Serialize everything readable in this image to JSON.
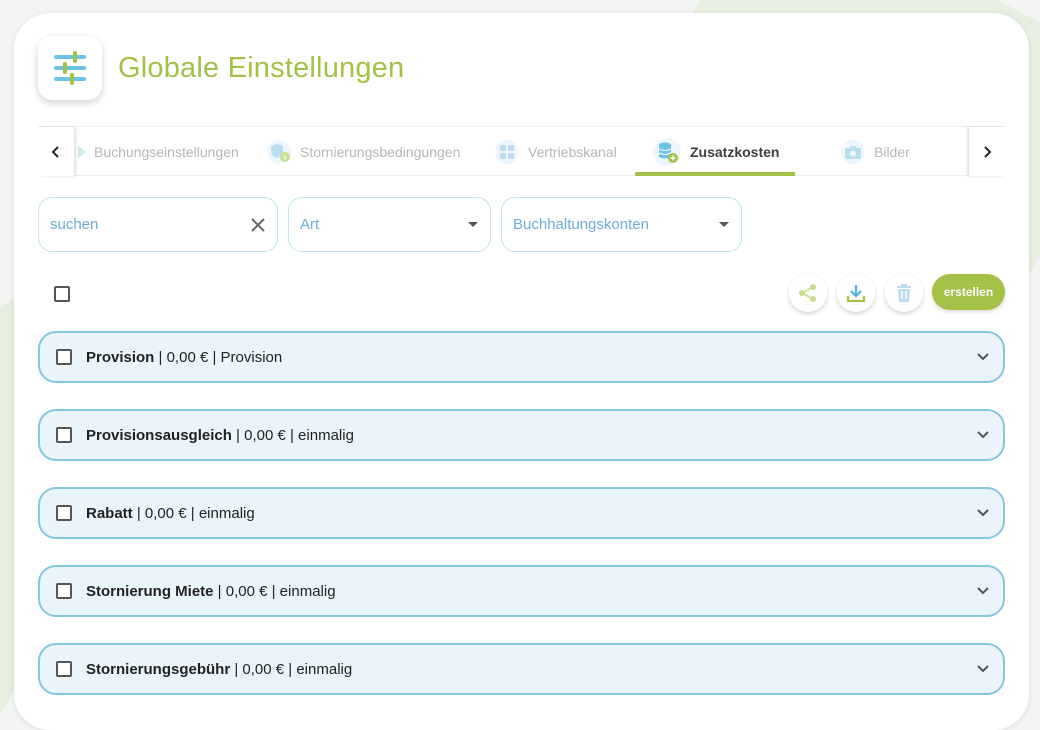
{
  "page": {
    "title": "Globale Einstellungen"
  },
  "tabs": [
    {
      "label": "Buchungseinstellungen",
      "icon": "arrow-icon",
      "active": false
    },
    {
      "label": "Stornierungsbedingungen",
      "icon": "shield-info-icon",
      "active": false
    },
    {
      "label": "Vertriebskanal",
      "icon": "grid-icon",
      "active": false
    },
    {
      "label": "Zusatzkosten",
      "icon": "database-add-icon",
      "active": true
    },
    {
      "label": "Bilder",
      "icon": "camera-icon",
      "active": false
    }
  ],
  "filters": {
    "search_placeholder": "suchen",
    "type_placeholder": "Art",
    "accounts_placeholder": "Buchhaltungskonten"
  },
  "toolbar": {
    "create_label": "erstellen"
  },
  "rows": [
    {
      "name": "Provision",
      "details": " | 0,00 € | Provision"
    },
    {
      "name": "Provisionsausgleich",
      "details": " | 0,00 € | einmalig"
    },
    {
      "name": "Rabatt",
      "details": " | 0,00 € | einmalig"
    },
    {
      "name": "Stornierung Miete",
      "details": " | 0,00 € | einmalig"
    },
    {
      "name": "Stornierungsgebühr",
      "details": " | 0,00 € | einmalig"
    }
  ],
  "colors": {
    "accent": "#a3c147",
    "row_border": "#84c7de",
    "row_bg": "#eaf4fb",
    "field_border": "#bfe4ee",
    "field_text": "#6aaed3"
  }
}
